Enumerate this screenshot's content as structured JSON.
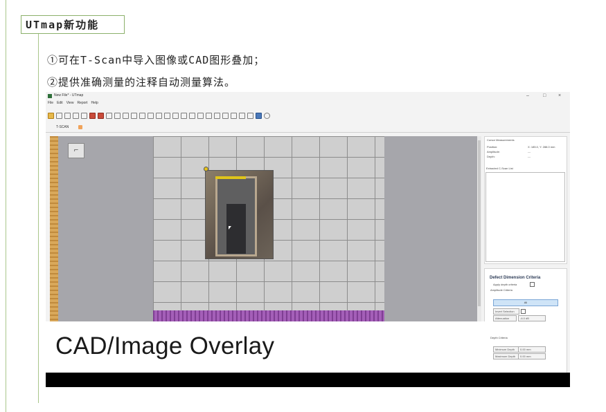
{
  "heading": "UTmap新功能",
  "features": [
    "①可在T-Scan中导入图像或CAD图形叠加；",
    "②提供准确测量的注释自动测量算法。"
  ],
  "app": {
    "window_title": "New File* - UTmap",
    "menu": [
      "File",
      "Edit",
      "View",
      "Report",
      "Help"
    ],
    "tab_label": "T-SCAN",
    "cursor_panel": {
      "title": "Cursor Measurements",
      "position_label": "Position:",
      "position_value": "X: 185.0, Y: 288.0 mm",
      "amplitude_label": "Amplitude:",
      "amplitude_value": "---",
      "depth_label": "Depth:",
      "depth_value": "---"
    },
    "cscan_list_label": "Extracted C-Scan List",
    "defect": {
      "title": "Defect Dimension Criteria",
      "apply_depth": "Apply depth criteria",
      "amplitude_criteria": "Amplitude Criteria",
      "all_button": "All",
      "invert_selection": "Invert Selection",
      "attenuation_label": "Attenuation",
      "attenuation_value": "-6.0 dB",
      "depth_criteria": "Depth Criteria",
      "min_depth_label": "Minimum Depth",
      "min_depth_value": "0.00 mm",
      "max_depth_label": "Maximum Depth",
      "max_depth_value": "0.00 mm"
    },
    "caption": "CAD/Image Overlay"
  },
  "colors": {
    "accent_border": "#8bb06a",
    "ruler_vertical": "#c08a3c",
    "ruler_horizontal": "#7f3e93"
  }
}
